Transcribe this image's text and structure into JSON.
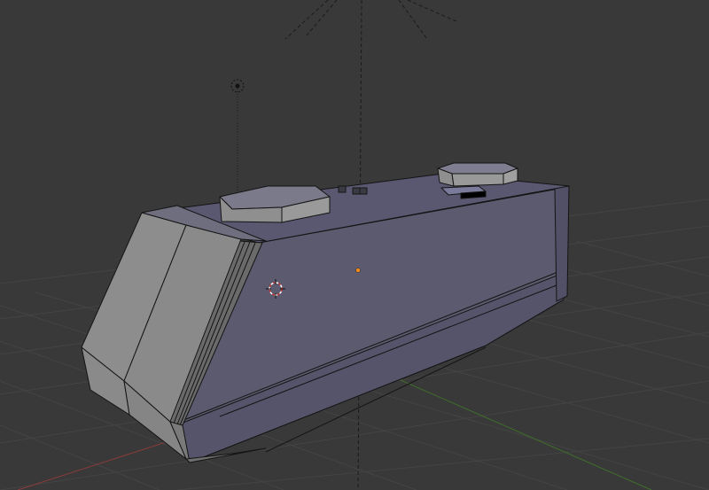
{
  "viewport": {
    "background": "#393939",
    "grid_color": "#444444",
    "x_axis_color": "#8a3b3b",
    "y_axis_color": "#3f6e2a",
    "model_face_color": "#5b5a6e",
    "model_front_color": "#8c8c8c",
    "model_edge_color": "#1a1a1a",
    "icons": {
      "lamp": "lamp-icon",
      "camera_target": "camera-target-icon",
      "cursor_3d": "3d-cursor-icon",
      "origin": "object-origin-icon"
    }
  }
}
